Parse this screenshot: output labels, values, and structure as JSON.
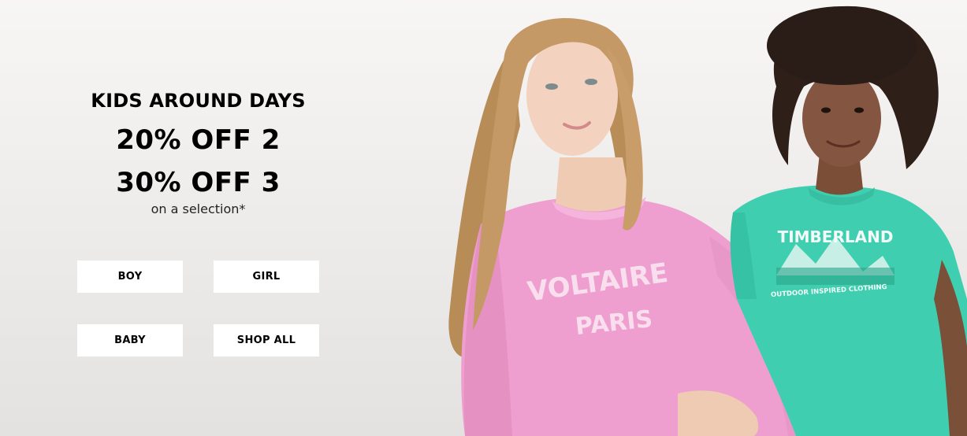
{
  "hero": {
    "eyebrow": "KIDS AROUND DAYS",
    "offer_1": "20% OFF 2",
    "offer_2": "30% OFF 3",
    "note": "on a selection*"
  },
  "buttons": {
    "boy": "BOY",
    "girl": "GIRL",
    "baby": "BABY",
    "shop_all": "SHOP ALL"
  },
  "photo": {
    "sweatshirt_text_1": "VOLTAIRE",
    "sweatshirt_text_2": "PARIS",
    "tshirt_text_1": "TIMBERLAND",
    "tshirt_text_2": "OUTDOOR INSPIRED CLOTHING"
  },
  "colors": {
    "background": "#f2f0ee",
    "sweatshirt": "#ee9fcf",
    "tshirt": "#3fcfb0",
    "button_bg": "#ffffff"
  }
}
